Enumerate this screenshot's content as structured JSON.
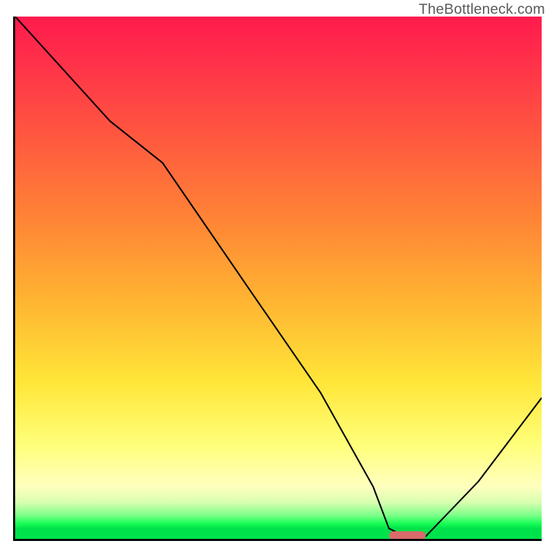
{
  "watermark": "TheBottleneck.com",
  "chart_data": {
    "type": "line",
    "title": "",
    "xlabel": "",
    "ylabel": "",
    "xlim": [
      0,
      100
    ],
    "ylim": [
      0,
      100
    ],
    "grid": false,
    "series": [
      {
        "name": "bottleneck-curve",
        "x": [
          0,
          18,
          28,
          45,
          58,
          68,
          71,
          74,
          78,
          88,
          100
        ],
        "values": [
          100,
          80,
          72,
          47,
          28,
          10,
          2,
          0.5,
          0.5,
          11,
          27
        ]
      }
    ],
    "annotations": [
      {
        "name": "optimal-marker",
        "x_start": 71,
        "x_end": 78,
        "y": 0.6,
        "color": "#d96b6b"
      }
    ],
    "background_gradient": {
      "type": "vertical",
      "stops": [
        {
          "pos": 0,
          "color": "#ff1a4d"
        },
        {
          "pos": 50,
          "color": "#ffb332"
        },
        {
          "pos": 82,
          "color": "#ffff7a"
        },
        {
          "pos": 97,
          "color": "#1bff58"
        },
        {
          "pos": 100,
          "color": "#00e24b"
        }
      ]
    }
  }
}
